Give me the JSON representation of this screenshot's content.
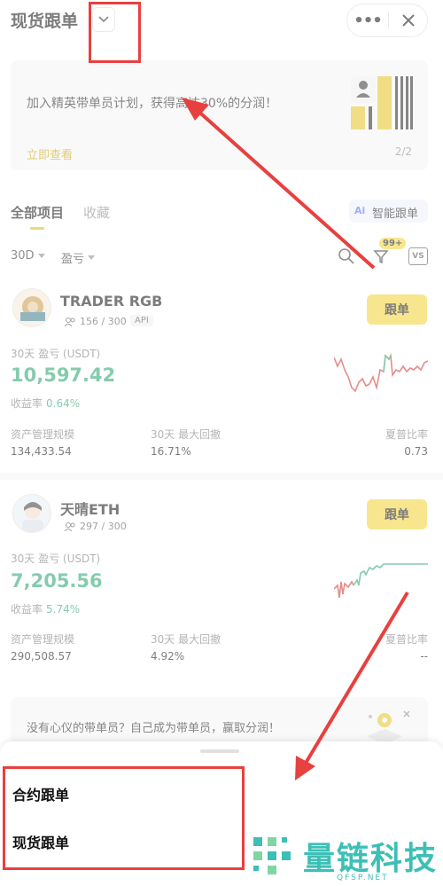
{
  "header": {
    "title": "现货跟单",
    "more_icon": "more-icon",
    "close_icon": "close-icon"
  },
  "banner": {
    "text": "加入精英带单员计划，获得高达30%的分润！",
    "link": "立即查看",
    "page": "2/2"
  },
  "tabs": {
    "all": "全部项目",
    "favorites": "收藏",
    "ai_badge": "Ai",
    "ai_label": "智能跟单"
  },
  "filters": {
    "period": "30D",
    "metric": "盈亏",
    "badge": "99+",
    "vs": "VS"
  },
  "traders": [
    {
      "name": "TRADER RGB",
      "followers": "156 / 300",
      "tag": "API",
      "button": "跟单",
      "pnl_label": "30天 盈亏 (USDT)",
      "pnl": "10,597.42",
      "roi_label": "收益率",
      "roi": "0.64%",
      "aum_label": "资产管理规模",
      "aum": "134,433.54",
      "mdd_label": "30天 最大回撤",
      "mdd": "16.71%",
      "sharpe_label": "夏普比率",
      "sharpe": "0.73"
    },
    {
      "name": "天晴ETH",
      "followers": "297 / 300",
      "button": "跟单",
      "pnl_label": "30天 盈亏 (USDT)",
      "pnl": "7,205.56",
      "roi_label": "收益率",
      "roi": "5.74%",
      "aum_label": "资产管理规模",
      "aum": "290,508.57",
      "mdd_label": "30天 最大回撤",
      "mdd": "4.92%",
      "sharpe_label": "夏普比率",
      "sharpe": "--"
    }
  ],
  "bottom_banner": {
    "text": "没有心仪的带单员？自己成为带单员，赢取分润！"
  },
  "sheet": {
    "options": [
      "合约跟单",
      "现货跟单"
    ]
  },
  "watermark": {
    "text": "量链科技",
    "url": "QFSP.NET"
  },
  "colors": {
    "accent": "#f2d232",
    "green": "#22a06b",
    "red": "#d0312d",
    "annotation": "#e8403f"
  }
}
